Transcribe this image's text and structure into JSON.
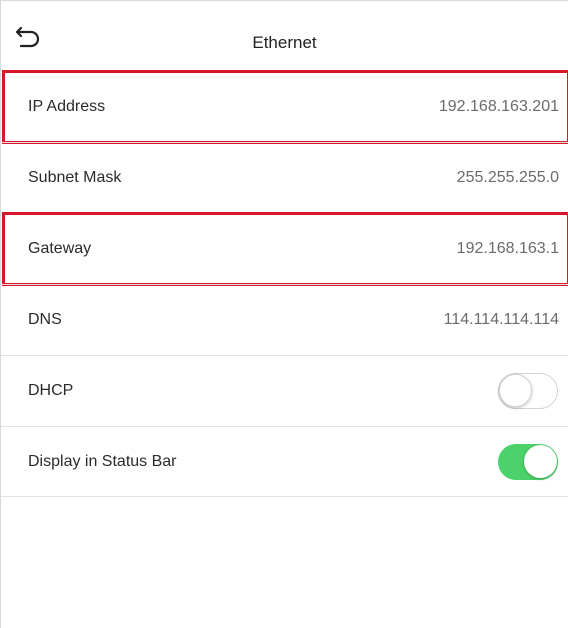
{
  "header": {
    "title": "Ethernet",
    "back_icon": "back-arrow-icon"
  },
  "colors": {
    "highlight": "#d7172a",
    "toggle_on": "#4cd26a",
    "toggle_off_border": "#d4d4d4"
  },
  "rows": [
    {
      "label": "IP Address",
      "value": "192.168.163.201",
      "highlighted": true
    },
    {
      "label": "Subnet Mask",
      "value": "255.255.255.0",
      "highlighted": false
    },
    {
      "label": "Gateway",
      "value": "192.168.163.1",
      "highlighted": true
    },
    {
      "label": "DNS",
      "value": "114.114.114.114",
      "highlighted": false
    },
    {
      "label": "DHCP",
      "toggle": "off"
    },
    {
      "label": "Display in Status Bar",
      "toggle": "on"
    }
  ]
}
